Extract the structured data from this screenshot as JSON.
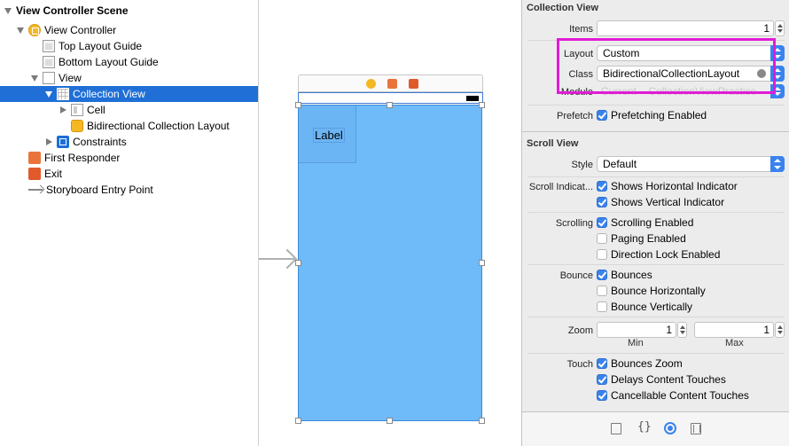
{
  "outline": {
    "items": [
      {
        "label": "View Controller Scene",
        "icon": "disclosure-triangle-icon",
        "expanded": true
      },
      {
        "label": "View Controller",
        "icon": "view-controller-icon"
      },
      {
        "label": "Top Layout Guide",
        "icon": "layout-guide-icon"
      },
      {
        "label": "Bottom Layout Guide",
        "icon": "layout-guide-icon"
      },
      {
        "label": "View",
        "icon": "view-icon"
      },
      {
        "label": "Collection View",
        "icon": "collection-view-icon",
        "selected": true
      },
      {
        "label": "Cell",
        "icon": "cell-icon"
      },
      {
        "label": "Bidirectional Collection Layout",
        "icon": "object-cube-icon"
      },
      {
        "label": "Constraints",
        "icon": "constraints-icon"
      },
      {
        "label": "First Responder",
        "icon": "first-responder-icon"
      },
      {
        "label": "Exit",
        "icon": "exit-icon"
      },
      {
        "label": "Storyboard Entry Point",
        "icon": "entry-point-arrow-icon"
      }
    ]
  },
  "canvas": {
    "cell_label": "Label"
  },
  "inspector": {
    "collection_view": {
      "title": "Collection View",
      "items_label": "Items",
      "items_value": "1",
      "layout_label": "Layout",
      "layout_value": "Custom",
      "class_label": "Class",
      "class_value": "BidirectionalCollectionLayout",
      "module_label": "Module",
      "module_value": "Current – CollectionViewPractice",
      "prefetch_label": "Prefetch",
      "prefetch_option": "Prefetching Enabled"
    },
    "scroll_view": {
      "title": "Scroll View",
      "style_label": "Style",
      "style_value": "Default",
      "indicators_label": "Scroll Indicat...",
      "shows_horizontal": "Shows Horizontal Indicator",
      "shows_vertical": "Shows Vertical Indicator",
      "scrolling_label": "Scrolling",
      "scrolling_enabled": "Scrolling Enabled",
      "paging_enabled": "Paging Enabled",
      "direction_lock": "Direction Lock Enabled",
      "bounce_label": "Bounce",
      "bounces": "Bounces",
      "bounce_h": "Bounce Horizontally",
      "bounce_v": "Bounce Vertically",
      "zoom_label": "Zoom",
      "zoom_min_value": "1",
      "zoom_max_value": "1",
      "zoom_min_label": "Min",
      "zoom_max_label": "Max",
      "touch_label": "Touch",
      "bounces_zoom": "Bounces Zoom",
      "delays_touches": "Delays Content Touches",
      "cancellable_touches": "Cancellable Content Touches"
    },
    "checkbox_states": {
      "prefetching": true,
      "shows_horizontal": true,
      "shows_vertical": true,
      "scrolling_enabled": true,
      "paging_enabled": false,
      "direction_lock": false,
      "bounces": true,
      "bounce_h": false,
      "bounce_v": false,
      "bounces_zoom": true,
      "delays_touches": true,
      "cancellable_touches": true
    },
    "tabs": [
      "file-inspector-icon",
      "quick-help-icon",
      "attributes-inspector-icon",
      "size-inspector-icon"
    ]
  },
  "colors": {
    "selection": "#1f6fd6",
    "collection_view_bg": "#6fbaf9",
    "highlight": "#e21bd6",
    "accent": "#3a83ee"
  }
}
